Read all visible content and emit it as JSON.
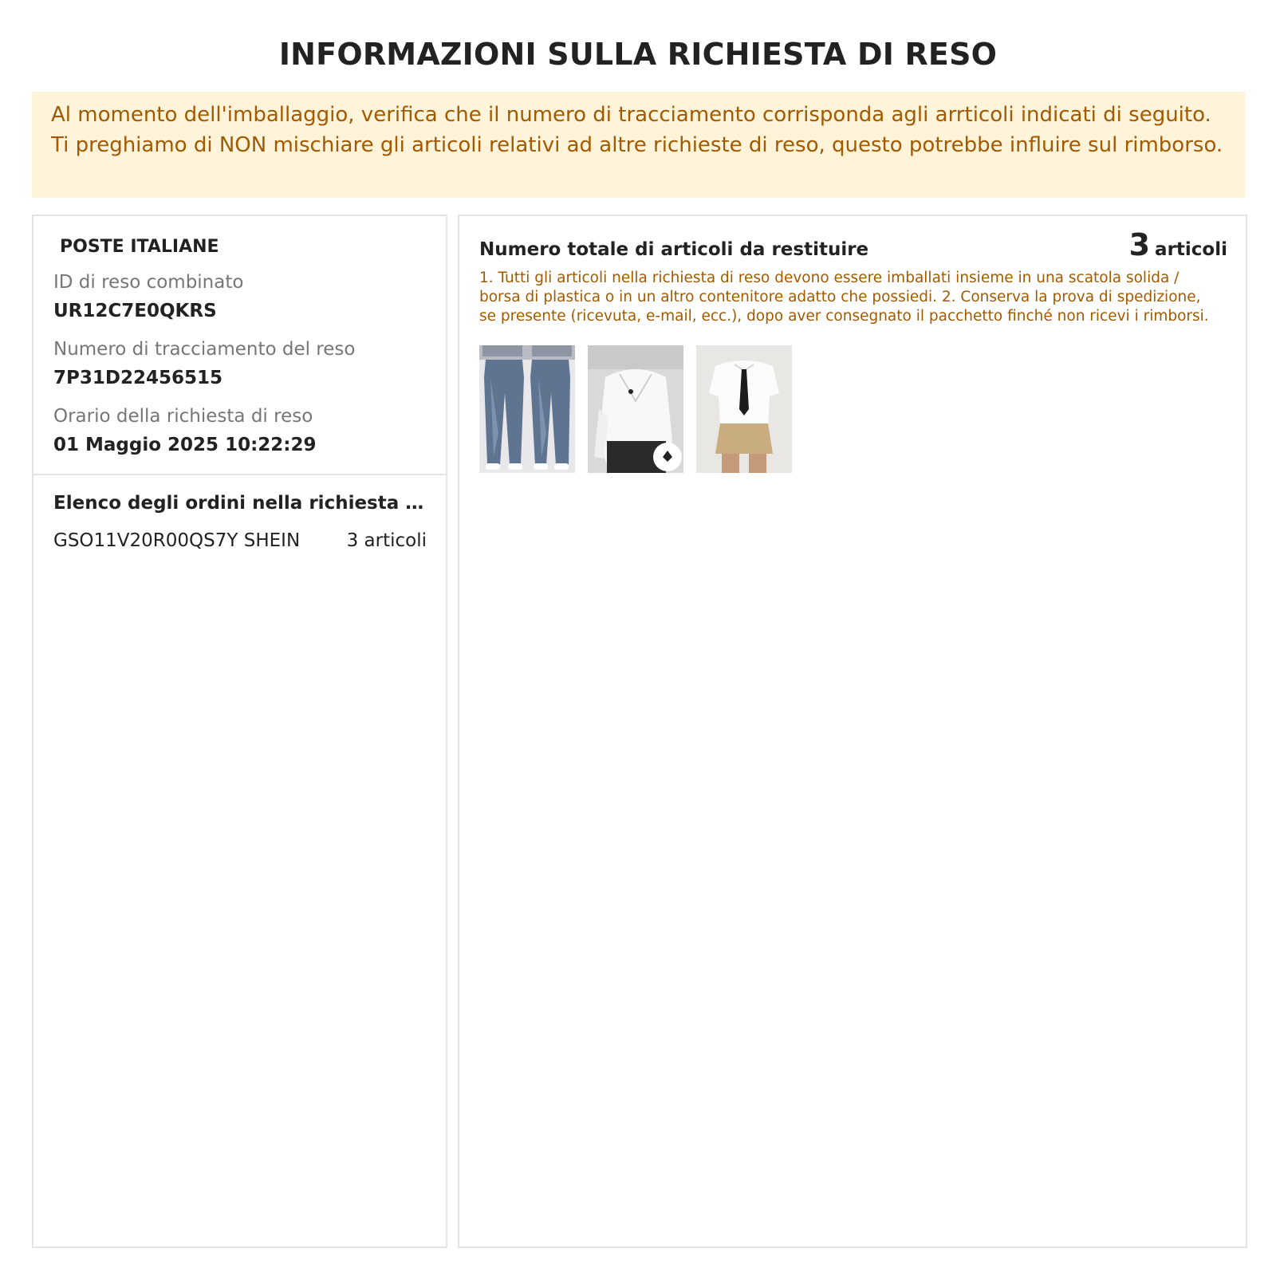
{
  "page": {
    "title": "INFORMAZIONI SULLA RICHIESTA DI RESO"
  },
  "notice": {
    "text": "Al momento dell'imballaggio, verifica che il numero di tracciamento corrisponda agli arrticoli indicati di seguito. Ti preghiamo di NON mischiare gli articoli relativi ad altre richieste di reso, questo potrebbe influire sul rimborso."
  },
  "info": {
    "carrier": "POSTE ITALIANE",
    "combined_id_label": "ID di reso combinato",
    "combined_id_value": "UR12C7E0QKRS",
    "tracking_label": "Numero di tracciamento del reso",
    "tracking_value": "7P31D22456515",
    "time_label": "Orario della richiesta di reso",
    "time_value": "01 Maggio 2025 10:22:29"
  },
  "orders": {
    "title": "Elenco degli ordini nella richiesta di reso",
    "items": [
      {
        "order": "GSO11V20R00QS7Y SHEIN",
        "count": "3 articoli"
      }
    ]
  },
  "summary": {
    "title": "Numero totale di articoli da restituire",
    "count": "3",
    "unit": "articoli",
    "instructions": "1. Tutti gli articoli nella richiesta di reso devono essere imballati insieme in una scatola solida / borsa di plastica o in un altro contenitore adatto che possiedi. 2. Conserva la prova di spedizione, se presente (ricevuta, e-mail, ecc.), dopo aver consegnato il pacchetto finché non ricevi i rimborsi."
  },
  "products": [
    {
      "icon": "jeans-product-image"
    },
    {
      "icon": "white-blouse-product-image"
    },
    {
      "icon": "shirt-tie-skirt-product-image"
    }
  ],
  "colors": {
    "notice_bg": "#fff3d9",
    "accent_text": "#a25a00",
    "border": "#e3e3e3"
  }
}
